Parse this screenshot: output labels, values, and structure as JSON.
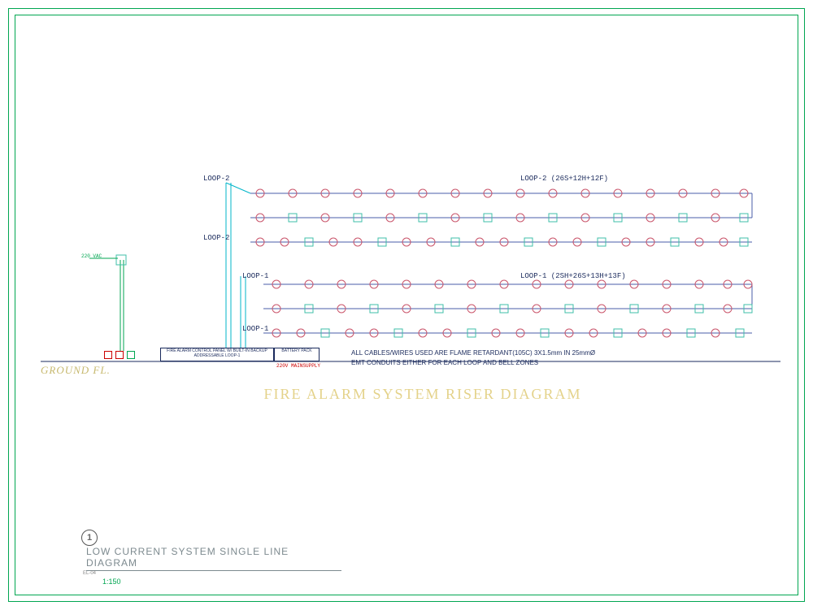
{
  "labels": {
    "loop2_l": "LOOP-2",
    "loop2_r": "LOOP-2 (26S+12H+12F)",
    "loop2_b": "LOOP-2",
    "loop1_l": "LOOP-1",
    "loop1_r": "LOOP-1 (2SH+26S+13H+13F)",
    "loop1_b": "LOOP-1",
    "ground": "GROUND  FL.",
    "big": "FIRE  ALARM  SYSTEM  RISER  DIAGRAM",
    "note1": "ALL CABLES/WIRES USED ARE FLAME RETARDANT(105C) 3X1.5mm  IN  25mmØ",
    "note2": "EMT CONDUITS EITHER FOR EACH LOOP AND BELL ZONES",
    "supply": "220V MAINSUPPLY",
    "panel1": "FIRE ALARM CONTROL PANEL W/ BUILT-IN BACKUP",
    "panel1b": "ADDRESSABLE LOOP-1",
    "panel2": "BATTERY PACK",
    "left1": "220 VAC"
  },
  "title": {
    "num": "1",
    "sub": "EL-04",
    "text": "LOW CURRENT SYSTEM SINGLE LINE DIAGRAM",
    "scale": "1:150"
  }
}
